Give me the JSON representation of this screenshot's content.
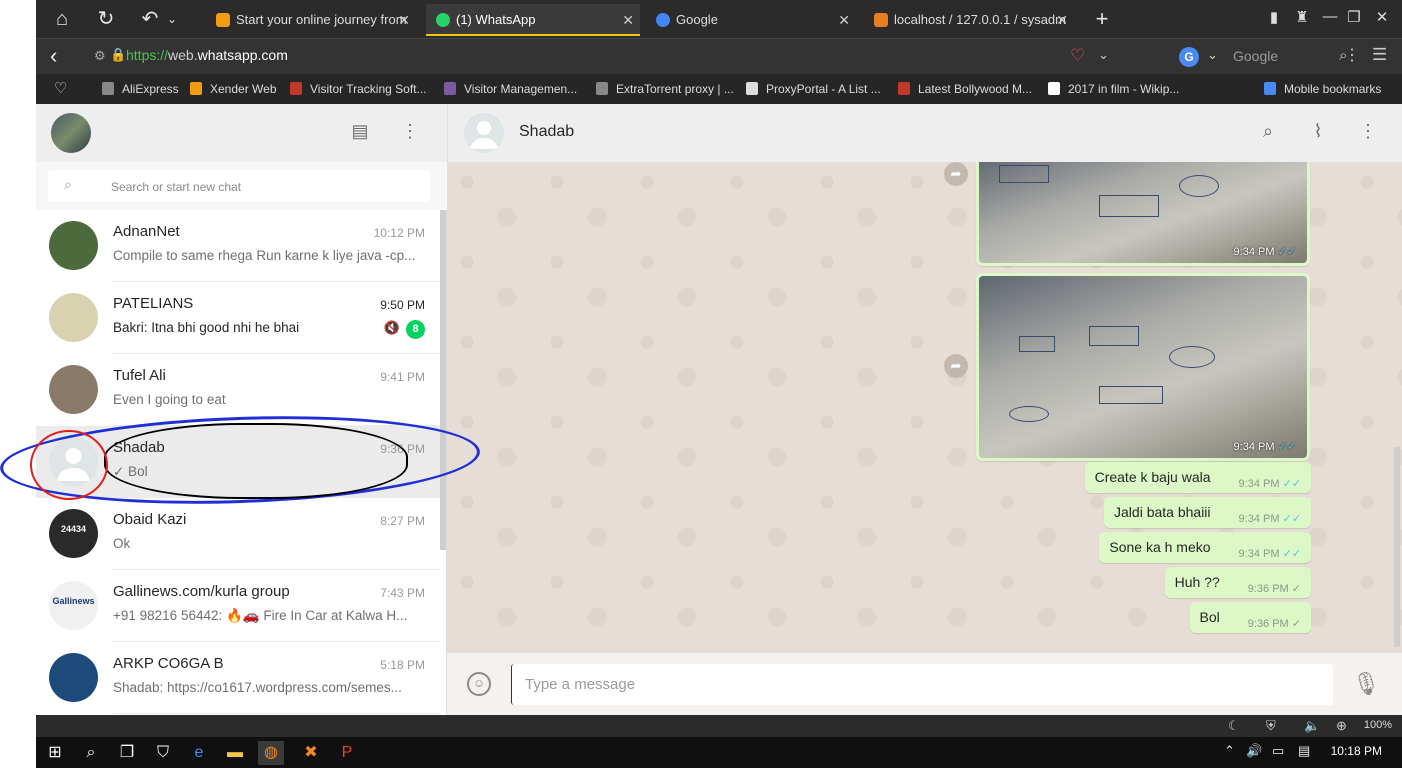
{
  "browser": {
    "tabs": [
      {
        "title": "Start your online journey from",
        "fav_color": "#f39c12"
      },
      {
        "title": "(1) WhatsApp",
        "fav_color": "#25d366"
      },
      {
        "title": "Google",
        "fav_color": "#4285f4"
      },
      {
        "title": "localhost / 127.0.0.1 / sysadm",
        "fav_color": "#e67e22"
      }
    ],
    "url_scheme": "https://",
    "url_host_pre": "web.",
    "url_host": "whatsapp.com",
    "search_placeholder": "Google",
    "bookmarks": [
      "AliExpress",
      "Xender Web",
      "Visitor Tracking Soft...",
      "Visitor Managemen...",
      "ExtraTorrent proxy | ...",
      "ProxyPortal - A List ...",
      "Latest Bollywood M...",
      "2017 in film - Wikip...",
      "Mobile bookmarks"
    ]
  },
  "sidebar": {
    "search_placeholder": "Search or start new chat",
    "chats": [
      {
        "name": "AdnanNet",
        "time": "10:12 PM",
        "preview": "Compile to same rhega Run karne k liye java -cp...",
        "avatar": "#4c6a3c"
      },
      {
        "name": "PATELIANS",
        "time": "9:50 PM",
        "preview": "Bakri: Itna bhi good nhi he bhai",
        "unread": "8",
        "avatar": "#d8d2b0"
      },
      {
        "name": "Tufel Ali",
        "time": "9:41 PM",
        "preview": "Even I going to eat",
        "avatar": "#8a7a6a"
      },
      {
        "name": "Shadab",
        "time": "9:36 PM",
        "preview": "✓ Bol",
        "avatar": "#dfe5e7"
      },
      {
        "name": "Obaid Kazi",
        "time": "8:27 PM",
        "preview": "Ok",
        "avatar": "#2a2a2a",
        "avatar_text": "24434"
      },
      {
        "name": "Gallinews.com/kurla group",
        "time": "7:43 PM",
        "preview": "+91 98216 56442: 🔥🚗 Fire In Car at Kalwa H...",
        "avatar": "#f0f0f0",
        "avatar_text": "Gallinews"
      },
      {
        "name": "ARKP CO6GA B",
        "time": "5:18 PM",
        "preview": "Shadab: https://co1617.wordpress.com/semes...",
        "avatar": "#1c4a7a"
      }
    ]
  },
  "conversation": {
    "contact_name": "Shadab",
    "image_messages": [
      {
        "time": "9:34 PM",
        "tick": "✓✓"
      },
      {
        "time": "9:34 PM",
        "tick": "✓✓"
      }
    ],
    "text_messages": [
      {
        "text": "Create k baju wala",
        "time": "9:34 PM",
        "tick": "✓✓",
        "read": true
      },
      {
        "text": "Jaldi bata bhaiii",
        "time": "9:34 PM",
        "tick": "✓✓",
        "read": true
      },
      {
        "text": "Sone ka h meko",
        "time": "9:34 PM",
        "tick": "✓✓",
        "read": true
      },
      {
        "text": "Huh ??",
        "time": "9:36 PM",
        "tick": "✓",
        "read": false
      },
      {
        "text": "Bol",
        "time": "9:36 PM",
        "tick": "✓",
        "read": false
      }
    ],
    "input_placeholder": "Type a message"
  },
  "statusbar": {
    "zoom": "100%"
  },
  "taskbar": {
    "clock": "10:18 PM"
  }
}
